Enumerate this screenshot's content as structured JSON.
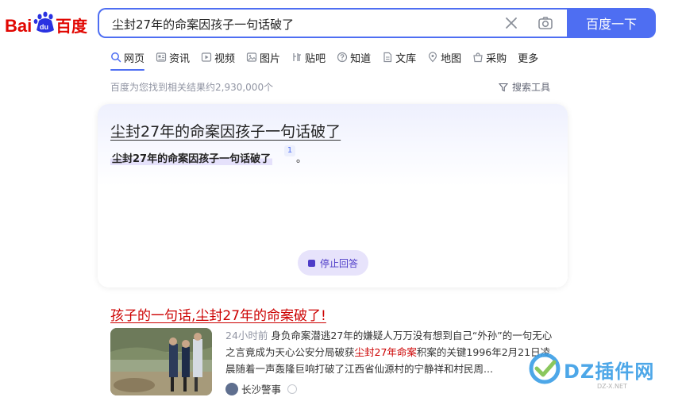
{
  "logo": {
    "text_bai": "Bai",
    "text_du_cn": "百度"
  },
  "search": {
    "query": "尘封27年的命案因孩子一句话破了",
    "button_label": "百度一下"
  },
  "tabs": [
    {
      "label": "网页",
      "icon": "search-icon",
      "active": true
    },
    {
      "label": "资讯",
      "icon": "news-icon"
    },
    {
      "label": "视频",
      "icon": "video-icon"
    },
    {
      "label": "图片",
      "icon": "image-icon"
    },
    {
      "label": "贴吧",
      "icon": "tieba-icon"
    },
    {
      "label": "知道",
      "icon": "question-icon"
    },
    {
      "label": "文库",
      "icon": "doc-icon"
    },
    {
      "label": "地图",
      "icon": "map-icon"
    },
    {
      "label": "采购",
      "icon": "shop-icon"
    },
    {
      "label": "更多",
      "icon": ""
    }
  ],
  "result_count": "百度为您找到相关结果约2,930,000个",
  "search_tools": "搜索工具",
  "ai_card": {
    "title": "尘封27年的命案因孩子一句话破了",
    "line": "尘封27年的命案因孩子一句话破了",
    "cite": "1",
    "period": "。",
    "stop_label": "停止回答"
  },
  "result": {
    "title_part1": "孩子的一句话,",
    "title_part2": "尘封27年的命案破了",
    "title_part3": "!",
    "time": "24小时前",
    "snippet_a": "身负命案潜逃27年的嫌疑人万万没有想到自己“外孙”的一句无心之言竟成为天心公安分局破获",
    "snippet_hl": "尘封27年命案",
    "snippet_b": "积案的关键1996年2月21日凌晨随着一声轰隆巨响打破了江西省仙源村的宁静祥和村民周...",
    "source": "长沙警事"
  },
  "watermark": {
    "text": "DZ插件网",
    "sub": "DZ-X.NET"
  },
  "colors": {
    "accent": "#4e6ef2",
    "title_red": "#cc0000",
    "ai_purple": "#4e3cc8"
  }
}
